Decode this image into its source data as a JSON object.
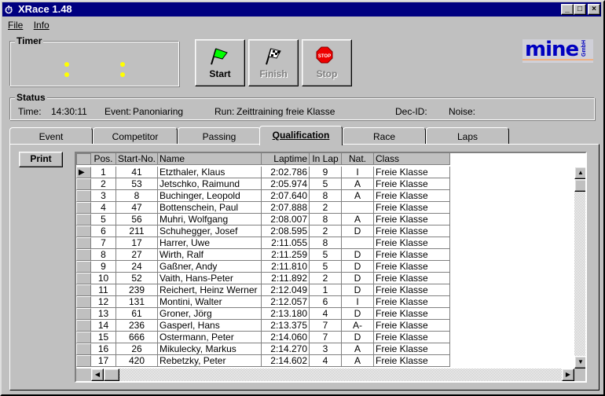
{
  "window": {
    "title": "XRace 1.48",
    "min": "_",
    "max": "□",
    "close": "×"
  },
  "menu": [
    {
      "label": "File"
    },
    {
      "label": "Info"
    }
  ],
  "timer": {
    "label": "Timer"
  },
  "buttons": {
    "start": "Start",
    "finish": "Finish",
    "stop": "Stop"
  },
  "logo": {
    "text": "mine",
    "sub": "GmbH"
  },
  "status": {
    "label": "Status",
    "time_label": "Time:",
    "time": "14:30:11",
    "event_label": "Event:",
    "event": "Panoniaring",
    "run_label": "Run:",
    "run": "Zeittraining freie Klasse",
    "dec_label": "Dec-ID:",
    "noise_label": "Noise:"
  },
  "tabs": [
    {
      "label": "Event"
    },
    {
      "label": "Competitor"
    },
    {
      "label": "Passing"
    },
    {
      "label": "Qualification",
      "active": true
    },
    {
      "label": "Race"
    },
    {
      "label": "Laps"
    }
  ],
  "print_label": "Print",
  "grid": {
    "columns": [
      "Pos.",
      "Start-No.",
      "Name",
      "Laptime",
      "In Lap",
      "Nat.",
      "Class"
    ],
    "rows": [
      [
        "1",
        "41",
        "Etzthaler, Klaus",
        "2:02.786",
        "9",
        "I",
        "Freie Klasse"
      ],
      [
        "2",
        "53",
        "Jetschko, Raimund",
        "2:05.974",
        "5",
        "A",
        "Freie Klasse"
      ],
      [
        "3",
        "8",
        "Buchinger, Leopold",
        "2:07.640",
        "8",
        "A",
        "Freie Klasse"
      ],
      [
        "4",
        "47",
        "Bottenschein, Paul",
        "2:07.888",
        "2",
        "",
        "Freie Klasse"
      ],
      [
        "5",
        "56",
        "Muhri, Wolfgang",
        "2:08.007",
        "8",
        "A",
        "Freie Klasse"
      ],
      [
        "6",
        "211",
        "Schuhegger, Josef",
        "2:08.595",
        "2",
        "D",
        "Freie Klasse"
      ],
      [
        "7",
        "17",
        "Harrer, Uwe",
        "2:11.055",
        "8",
        "",
        "Freie Klasse"
      ],
      [
        "8",
        "27",
        "Wirth, Ralf",
        "2:11.259",
        "5",
        "D",
        "Freie Klasse"
      ],
      [
        "9",
        "24",
        "Gaßner, Andy",
        "2:11.810",
        "5",
        "D",
        "Freie Klasse"
      ],
      [
        "10",
        "52",
        "Vaith, Hans-Peter",
        "2:11.892",
        "2",
        "D",
        "Freie Klasse"
      ],
      [
        "11",
        "239",
        "Reichert, Heinz Werner",
        "2:12.049",
        "1",
        "D",
        "Freie Klasse"
      ],
      [
        "12",
        "131",
        "Montini, Walter",
        "2:12.057",
        "6",
        "I",
        "Freie Klasse"
      ],
      [
        "13",
        "61",
        "Groner, Jörg",
        "2:13.180",
        "4",
        "D",
        "Freie Klasse"
      ],
      [
        "14",
        "236",
        "Gasperl, Hans",
        "2:13.375",
        "7",
        "A-",
        "Freie Klasse"
      ],
      [
        "15",
        "666",
        "Ostermann, Peter",
        "2:14.060",
        "7",
        "D",
        "Freie Klasse"
      ],
      [
        "16",
        "26",
        "Mikulecky, Markus",
        "2:14.270",
        "3",
        "A",
        "Freie Klasse"
      ],
      [
        "17",
        "420",
        "Rebetzky, Peter",
        "2:14.602",
        "4",
        "A",
        "Freie Klasse"
      ]
    ]
  }
}
